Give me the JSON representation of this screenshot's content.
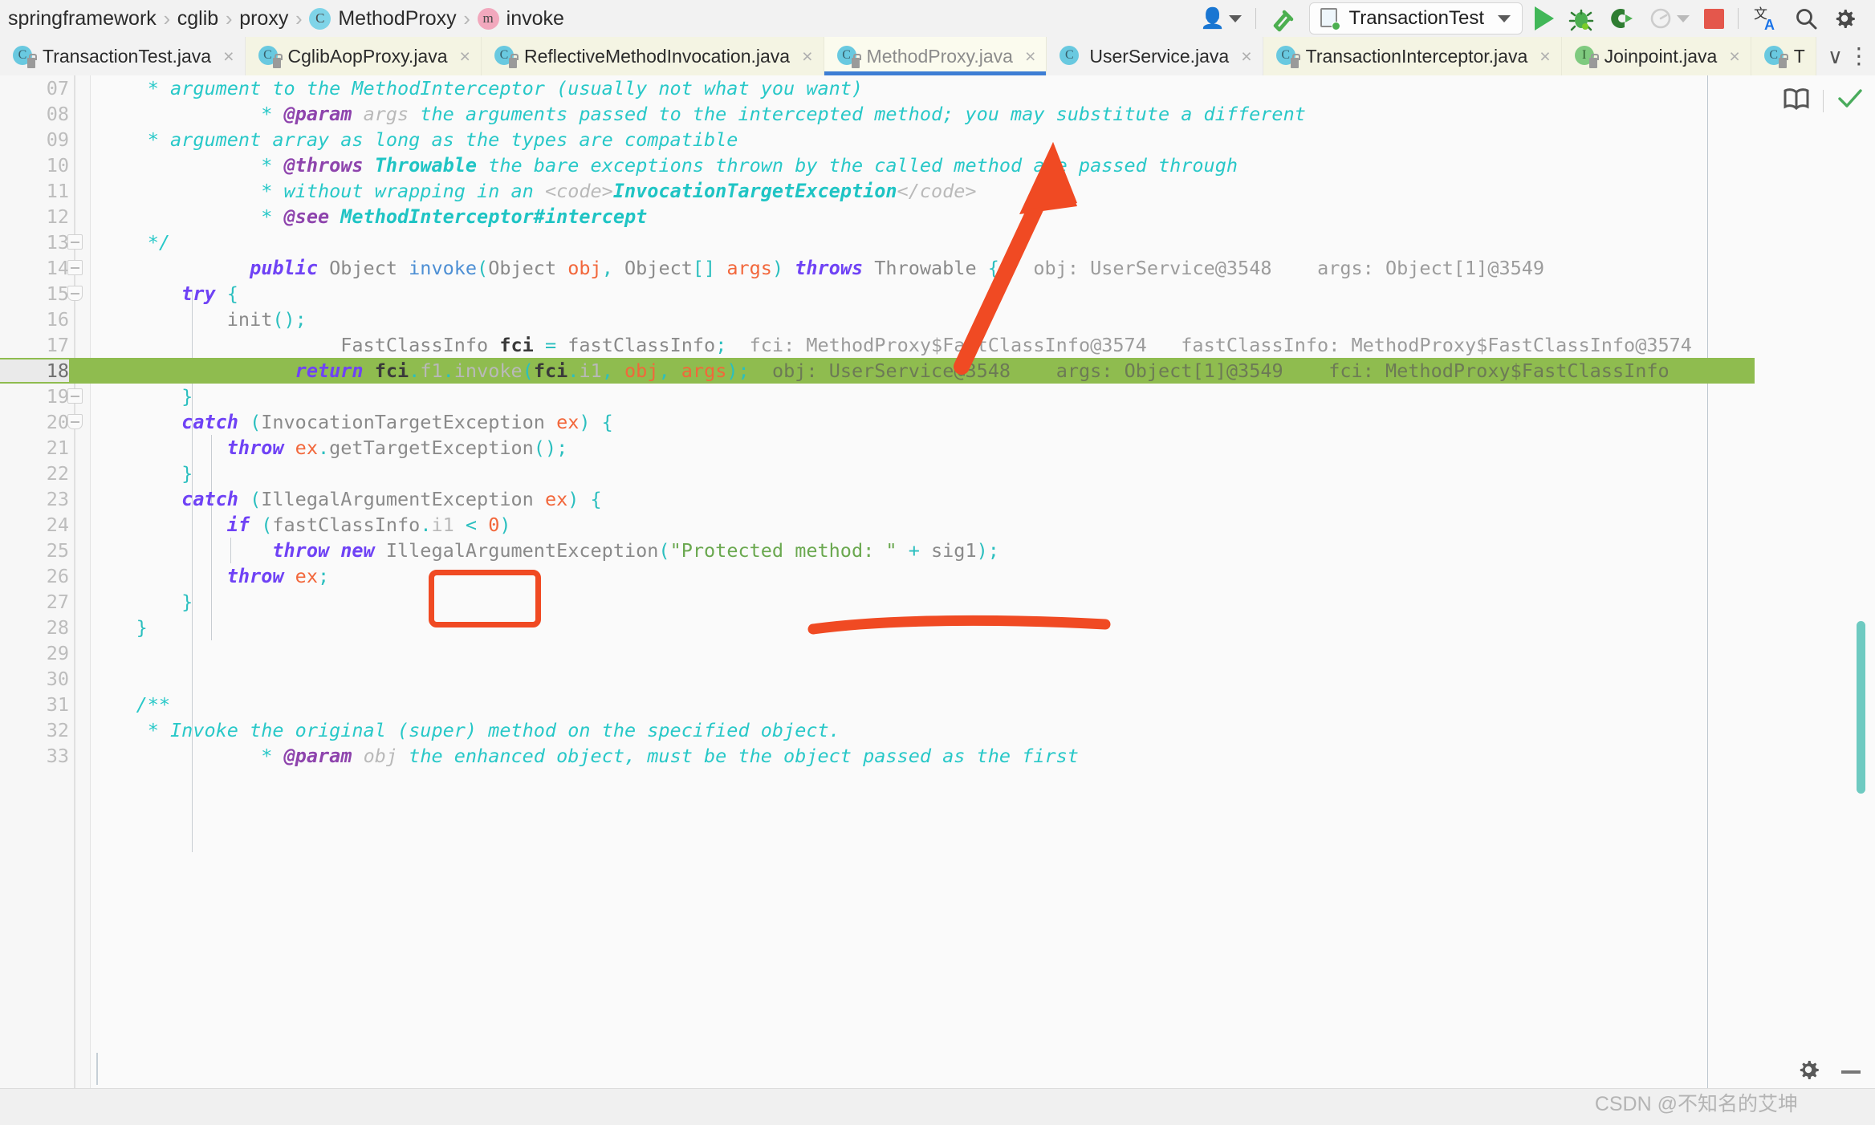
{
  "breadcrumb": {
    "items": [
      {
        "label": "springframework",
        "icon": null
      },
      {
        "label": "cglib",
        "icon": null
      },
      {
        "label": "proxy",
        "icon": null
      },
      {
        "label": "MethodProxy",
        "icon": "class-icon",
        "badge": "C"
      },
      {
        "label": "invoke",
        "icon": "method-icon",
        "badge": "m"
      }
    ],
    "separator": "›"
  },
  "toolbar": {
    "user_icon": "user-profile-icon",
    "build_icon": "build-hammer-icon",
    "run_configuration": "TransactionTest",
    "run_label": "Run",
    "debug_label": "Debug",
    "coverage_label": "Run with Coverage",
    "profiler_label": "Profiler",
    "stop_label": "Stop",
    "translate_label": "Translate",
    "search_label": "Search Everywhere",
    "settings_label": "Settings",
    "accent_run": "#41b758",
    "accent_stop": "#e4574c"
  },
  "tabs": [
    {
      "label": "TransactionTest.java",
      "icon": "java-class-icon",
      "active": false,
      "modified_bg": false
    },
    {
      "label": "CglibAopProxy.java",
      "icon": "java-class-icon",
      "active": false,
      "modified_bg": true
    },
    {
      "label": "ReflectiveMethodInvocation.java",
      "icon": "java-class-icon",
      "active": false,
      "modified_bg": true
    },
    {
      "label": "MethodProxy.java",
      "icon": "java-class-icon",
      "active": true,
      "modified_bg": false
    },
    {
      "label": "UserService.java",
      "icon": "java-class-icon",
      "active": false,
      "modified_bg": false
    },
    {
      "label": "TransactionInterceptor.java",
      "icon": "java-class-icon",
      "active": false,
      "modified_bg": true
    },
    {
      "label": "Joinpoint.java",
      "icon": "java-interface-icon",
      "active": false,
      "modified_bg": true
    },
    {
      "label": "T",
      "icon": "java-class-icon",
      "active": false,
      "modified_bg": false
    }
  ],
  "tab_close_glyph": "×",
  "tab_overflow_glyph": "∨",
  "tab_kebab_glyph": "⋮",
  "editor": {
    "filename": "MethodProxy.java",
    "current_line": 18,
    "highlight_color": "#8fbc4f",
    "scrollbar_color": "#6ecac1",
    "right_icons": [
      {
        "name": "reader-mode-icon"
      },
      {
        "name": "inspection-ok-icon"
      }
    ],
    "lines": [
      {
        "num": "07",
        "indent": 0
      },
      {
        "num": "08",
        "indent": 0
      },
      {
        "num": "09",
        "indent": 0
      },
      {
        "num": "10",
        "indent": 0
      },
      {
        "num": "11",
        "indent": 0
      },
      {
        "num": "12",
        "indent": 0
      },
      {
        "num": "13",
        "indent": 0
      },
      {
        "num": "14",
        "indent": 0
      },
      {
        "num": "15",
        "indent": 0
      },
      {
        "num": "16",
        "indent": 0
      },
      {
        "num": "17",
        "indent": 0
      },
      {
        "num": "18",
        "indent": 0
      },
      {
        "num": "19",
        "indent": 0
      },
      {
        "num": "20",
        "indent": 0
      },
      {
        "num": "21",
        "indent": 0
      },
      {
        "num": "22",
        "indent": 0
      },
      {
        "num": "23",
        "indent": 0
      },
      {
        "num": "24",
        "indent": 0
      },
      {
        "num": "25",
        "indent": 0
      },
      {
        "num": "26",
        "indent": 0
      },
      {
        "num": "27",
        "indent": 0
      },
      {
        "num": "28",
        "indent": 0
      },
      {
        "num": "29",
        "indent": 0
      },
      {
        "num": "30",
        "indent": 0
      },
      {
        "num": "31",
        "indent": 0
      },
      {
        "num": "32",
        "indent": 0
      },
      {
        "num": "33",
        "indent": 0
      }
    ],
    "code_text": {
      "l07": "     * argument to the MethodInterceptor (usually not what you want)",
      "l08": "     * @param args the arguments passed to the intercepted method; you may substitute a different",
      "l09": "     * argument array as long as the types are compatible",
      "l10": "     * @throws Throwable the bare exceptions thrown by the called method are passed through",
      "l11": "     * without wrapping in an <code>InvocationTargetException</code>",
      "l12": "     * @see MethodInterceptor#intercept",
      "l13": "     */",
      "l14": "    public Object invoke(Object obj, Object[] args) throws Throwable {",
      "l15": "        try {",
      "l16": "            init();",
      "l17": "            FastClassInfo fci = fastClassInfo;",
      "l18": "            return fci.f1.invoke(fci.i1, obj, args);",
      "l19": "        }",
      "l20": "        catch (InvocationTargetException ex) {",
      "l21": "            throw ex.getTargetException();",
      "l22": "        }",
      "l23": "        catch (IllegalArgumentException ex) {",
      "l24": "            if (fastClassInfo.i1 < 0)",
      "l25": "                throw new IllegalArgumentException(\"Protected method: \" + sig1);",
      "l26": "            throw ex;",
      "l27": "        }",
      "l28": "    }",
      "l29": "",
      "l30": "",
      "l31": "    /**",
      "l32": "     * Invoke the original (super) method on the specified object.",
      "l33": "     * @param obj the enhanced object, must be the object passed as the first"
    },
    "debug_hints": {
      "line14_obj": "obj: UserService@3548",
      "line14_args": "args: Object[1]@3549",
      "line17_fci": "fci: MethodProxy$FastClassInfo@3574",
      "line17_fastClassInfo": "fastClassInfo: MethodProxy$FastClassInfo@3574",
      "line18_obj": "obj: UserService@3548",
      "line18_args": "args: Object[1]@3549",
      "line18_fci": "fci: MethodProxy$FastClassInfo"
    }
  },
  "annotations": {
    "arrow_target": "MethodProxy.java tab",
    "rect_target": "invoke(",
    "underline_target": "obj: UserService@3548",
    "marker_color": "#f04a23"
  },
  "statusbar": {
    "watermark": "CSDN @不知名的艾坤",
    "gear_icon": "settings-gear-icon",
    "minimize_icon": "minimize-icon"
  }
}
